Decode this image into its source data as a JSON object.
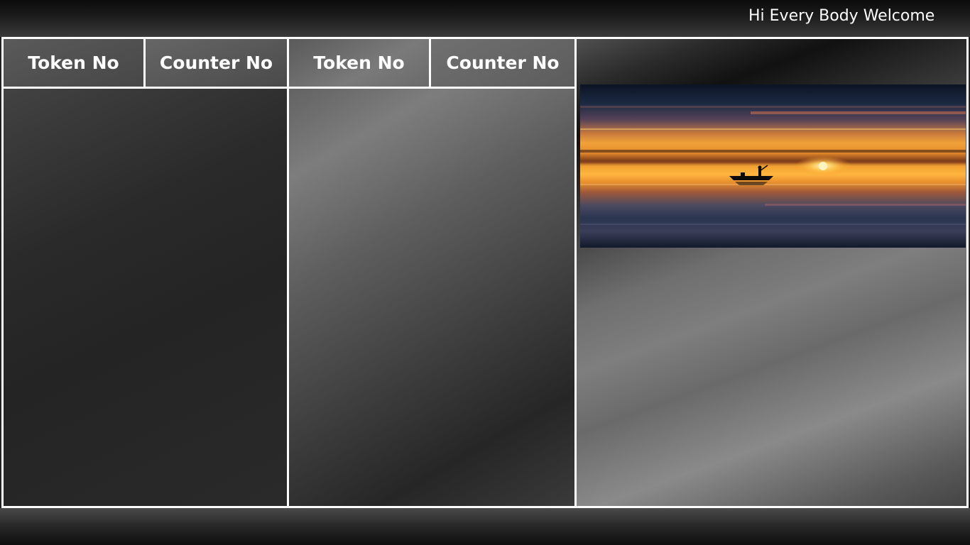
{
  "header": {
    "marquee_text": "Hi Every Body Welcome"
  },
  "queue_panels": [
    {
      "token_header": "Token No",
      "counter_header": "Counter No"
    },
    {
      "token_header": "Token No",
      "counter_header": "Counter No"
    }
  ],
  "media": {
    "image_icon": "sunset-boat-image"
  }
}
